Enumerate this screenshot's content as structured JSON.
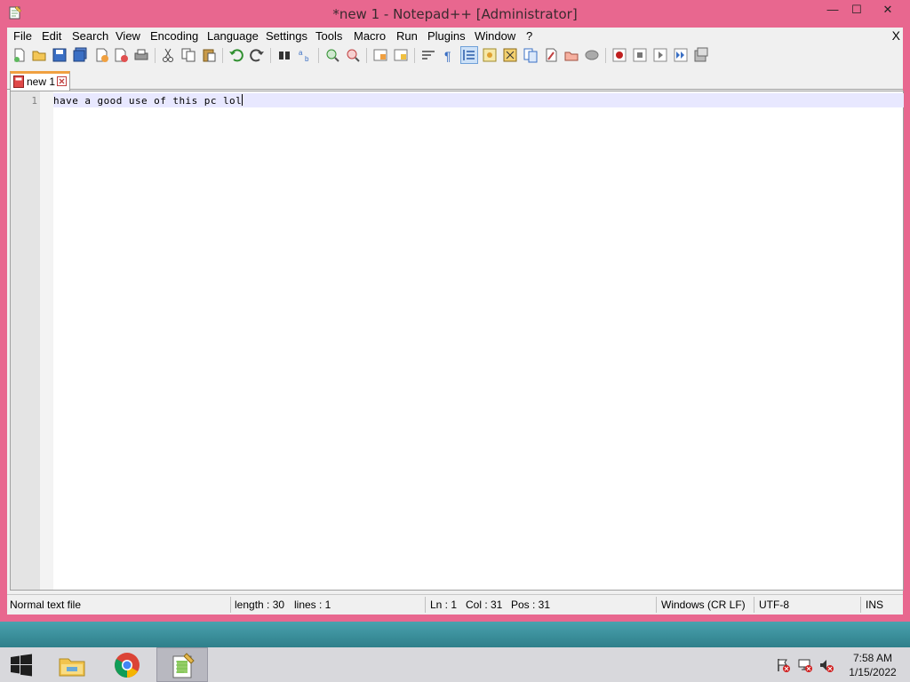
{
  "window": {
    "title": "*new 1 - Notepad++ [Administrator]",
    "controls": {
      "minimize": "—",
      "maximize": "☐",
      "close": "✕"
    }
  },
  "menu": {
    "items": [
      "File",
      "Edit",
      "Search",
      "View",
      "Encoding",
      "Language",
      "Settings",
      "Tools",
      "Macro",
      "Run",
      "Plugins",
      "Window",
      "?"
    ],
    "close_label": "X"
  },
  "tab": {
    "label": "new 1"
  },
  "editor": {
    "line_number": "1",
    "text": "have a good use of this pc lol"
  },
  "status": {
    "file_type": "Normal text file",
    "length": "length : 30",
    "lines": "lines : 1",
    "ln": "Ln : 1",
    "col": "Col : 31",
    "pos": "Pos : 31",
    "eol": "Windows (CR LF)",
    "encoding": "UTF-8",
    "mode": "INS"
  },
  "taskbar": {
    "time": "7:58 AM",
    "date": "1/15/2022"
  },
  "colors": {
    "window_border": "#e8678f",
    "current_line": "#e8e8ff",
    "gutter": "#e4e4e4"
  }
}
